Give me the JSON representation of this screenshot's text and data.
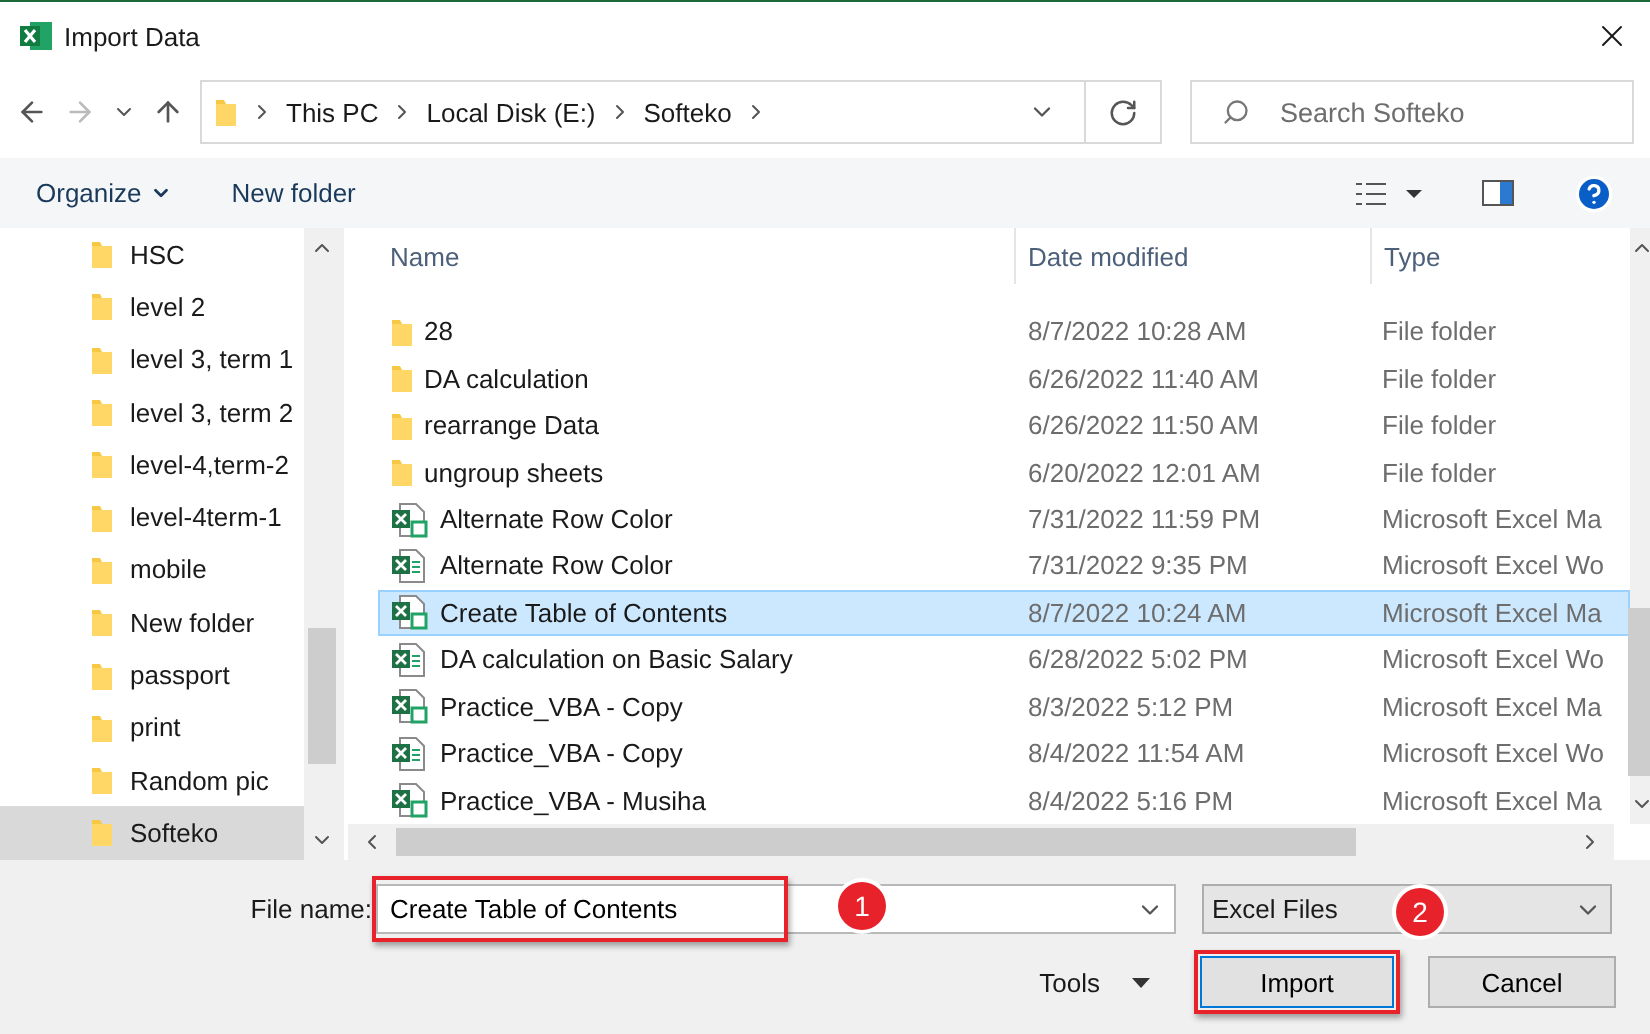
{
  "window": {
    "title": "Import Data"
  },
  "nav": {
    "breadcrumb": [
      "This PC",
      "Local Disk (E:)",
      "Softeko"
    ],
    "search": {
      "placeholder": "Search Softeko"
    }
  },
  "toolbar": {
    "organize": "Organize",
    "new_folder": "New folder"
  },
  "sidebar": {
    "items": [
      {
        "label": "HSC",
        "selected": false
      },
      {
        "label": "level 2",
        "selected": false
      },
      {
        "label": "level 3, term 1",
        "selected": false
      },
      {
        "label": "level 3, term 2",
        "selected": false
      },
      {
        "label": "level-4,term-2",
        "selected": false
      },
      {
        "label": "level-4term-1",
        "selected": false
      },
      {
        "label": "mobile",
        "selected": false
      },
      {
        "label": "New folder",
        "selected": false
      },
      {
        "label": "passport",
        "selected": false
      },
      {
        "label": "print",
        "selected": false
      },
      {
        "label": "Random pic",
        "selected": false
      },
      {
        "label": "Softeko",
        "selected": true
      }
    ]
  },
  "file_list": {
    "columns": [
      "Name",
      "Date modified",
      "Type"
    ],
    "rows": [
      {
        "kind": "folder",
        "name": "28",
        "date": "8/7/2022 10:28 AM",
        "type": "File folder",
        "selected": false
      },
      {
        "kind": "folder",
        "name": "DA calculation",
        "date": "6/26/2022 11:40 AM",
        "type": "File folder",
        "selected": false
      },
      {
        "kind": "folder",
        "name": "rearrange Data",
        "date": "6/26/2022 11:50 AM",
        "type": "File folder",
        "selected": false
      },
      {
        "kind": "folder",
        "name": "ungroup sheets",
        "date": "6/20/2022 12:01 AM",
        "type": "File folder",
        "selected": false
      },
      {
        "kind": "macro",
        "name": "Alternate Row Color",
        "date": "7/31/2022 11:59 PM",
        "type": "Microsoft Excel Ma",
        "selected": false
      },
      {
        "kind": "workbook",
        "name": "Alternate Row Color",
        "date": "7/31/2022 9:35 PM",
        "type": "Microsoft Excel Wo",
        "selected": false
      },
      {
        "kind": "macro",
        "name": "Create Table of Contents",
        "date": "8/7/2022 10:24 AM",
        "type": "Microsoft Excel Ma",
        "selected": true
      },
      {
        "kind": "workbook",
        "name": "DA calculation on Basic Salary",
        "date": "6/28/2022 5:02 PM",
        "type": "Microsoft Excel Wo",
        "selected": false
      },
      {
        "kind": "macro",
        "name": "Practice_VBA - Copy",
        "date": "8/3/2022 5:12 PM",
        "type": "Microsoft Excel Ma",
        "selected": false
      },
      {
        "kind": "workbook",
        "name": "Practice_VBA - Copy",
        "date": "8/4/2022 11:54 AM",
        "type": "Microsoft Excel Wo",
        "selected": false
      },
      {
        "kind": "macro",
        "name": "Practice_VBA - Musiha",
        "date": "8/4/2022 5:16 PM",
        "type": "Microsoft Excel Ma",
        "selected": false
      }
    ]
  },
  "footer": {
    "file_name_label": "File name:",
    "file_name": {
      "value": "Create Table of Contents",
      "callout": "1",
      "framed": true
    },
    "file_type": {
      "value": "Excel Files",
      "callout": "2"
    },
    "tools": "Tools",
    "buttons": [
      {
        "label": "Import",
        "kind": "primary",
        "framed": true
      },
      {
        "label": "Cancel",
        "kind": "normal",
        "framed": false
      }
    ]
  }
}
